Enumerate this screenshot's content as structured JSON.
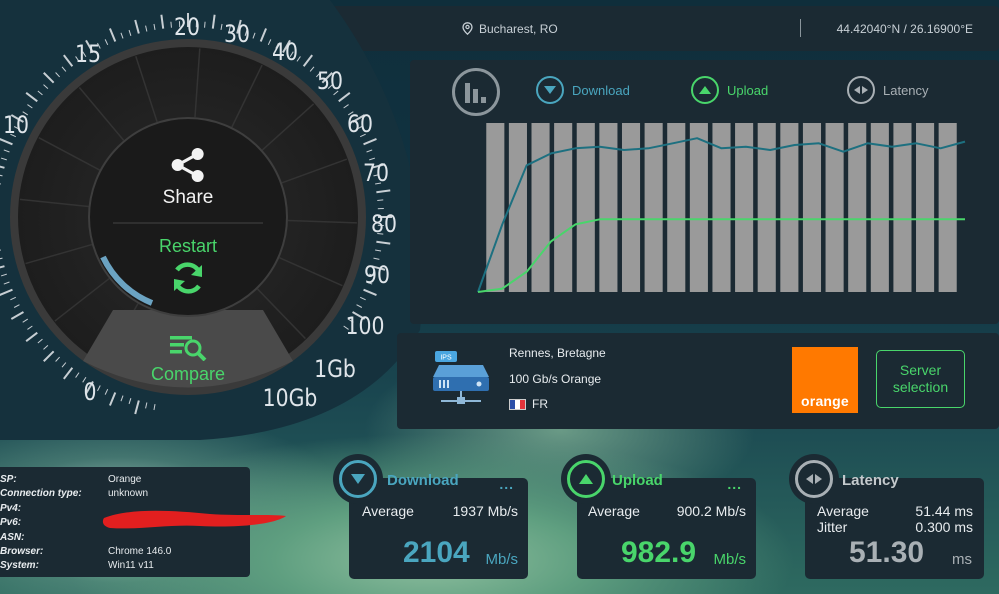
{
  "location": {
    "city": "Bucharest, RO",
    "coords": "44.42040°N / 26.16900°E"
  },
  "gauge": {
    "scale": [
      "0",
      "10",
      "15",
      "20",
      "30",
      "40",
      "50",
      "60",
      "70",
      "80",
      "90",
      "100",
      "1Gb",
      "10Gb"
    ],
    "share_label": "Share",
    "restart_label": "Restart",
    "compare_label": "Compare",
    "progress_fraction": 0.22
  },
  "legend": {
    "download": "Download",
    "upload": "Upload",
    "latency": "Latency"
  },
  "chart_data": {
    "type": "line",
    "bar_count": 21,
    "series": [
      {
        "values": [
          0.0,
          0.4,
          0.75,
          0.82,
          0.85,
          0.86,
          0.84,
          0.85,
          0.88,
          0.91,
          0.85,
          0.86,
          0.84,
          0.87,
          0.88,
          0.83,
          0.88,
          0.86,
          0.88,
          0.85,
          0.89
        ]
      },
      {
        "values": [
          0.0,
          0.02,
          0.12,
          0.3,
          0.4,
          0.43,
          0.43,
          0.43,
          0.43,
          0.43,
          0.43,
          0.43,
          0.43,
          0.43,
          0.43,
          0.43,
          0.43,
          0.43,
          0.43,
          0.43,
          0.43
        ]
      }
    ],
    "colors": {
      "download": "#1d7080",
      "upload": "#49d56b",
      "bars": "#9a9a9a"
    }
  },
  "server": {
    "badge": "IPS",
    "city": "Rennes, Bretagne",
    "capacity": "100 Gb/s Orange",
    "country": "FR",
    "logo_text": "orange",
    "button_label": "Server selection"
  },
  "info": {
    "rows": [
      {
        "key": "SP:",
        "value": "Orange"
      },
      {
        "key": "Connection type:",
        "value": "unknown"
      },
      {
        "key": "Pv4:",
        "value": ""
      },
      {
        "key": "Pv6:",
        "value": ""
      },
      {
        "key": "ASN:",
        "value": ""
      },
      {
        "key": "Browser:",
        "value": "Chrome 146.0"
      },
      {
        "key": "System:",
        "value": "Win11 v11"
      }
    ]
  },
  "results": {
    "download": {
      "title": "Download",
      "dots": "...",
      "avg_label": "Average",
      "avg_value": "1937 Mb/s",
      "big": "2104",
      "unit": "Mb/s",
      "color": "#4aa6bf"
    },
    "upload": {
      "title": "Upload",
      "dots": "...",
      "avg_label": "Average",
      "avg_value": "900.2 Mb/s",
      "big": "982.9",
      "unit": "Mb/s",
      "color": "#49d56b"
    },
    "latency": {
      "title": "Latency",
      "avg_label": "Average",
      "avg_value": "51.44 ms",
      "jitter_label": "Jitter",
      "jitter_value": "0.300 ms",
      "big": "51.30",
      "unit": "ms",
      "color": "#a9b0b5"
    }
  },
  "colors": {
    "accent_green": "#49d56b",
    "accent_teal": "#4aa6bf",
    "panel": "#1b2a33",
    "orange": "#ff7900"
  }
}
